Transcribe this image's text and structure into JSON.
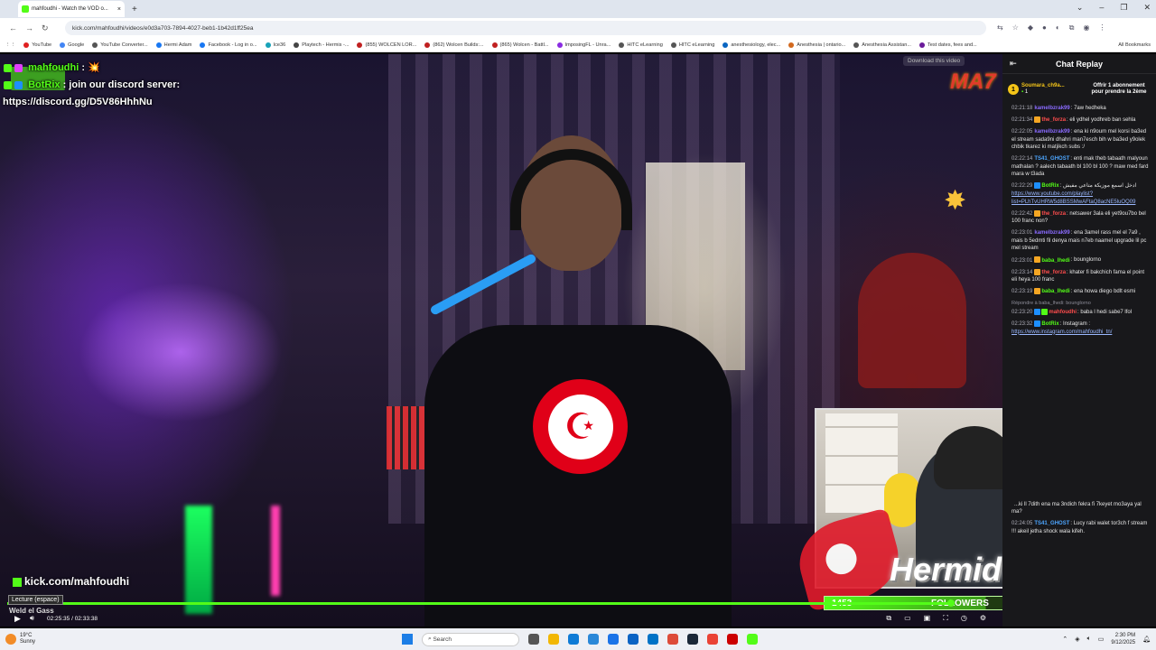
{
  "browser": {
    "tab_title": "mahfoudhi - Watch the VOD o...",
    "tab_close": "×",
    "new_tab": "+",
    "win_controls": [
      "⌄",
      "–",
      "❐",
      "✕"
    ],
    "nav": [
      "←",
      "→",
      "↻"
    ],
    "url": "kick.com/mahfoudhi/videos/e0d3a703-7894-4027-beb1-1b42d1ff25ea",
    "bookmarks": [
      {
        "label": "YouTube",
        "color": "#e02020"
      },
      {
        "label": "Google",
        "color": "#4285f4"
      },
      {
        "label": "YouTube Converter...",
        "color": "#555555"
      },
      {
        "label": "Hermi Adam",
        "color": "#1877f2"
      },
      {
        "label": "Facebook - Log in o...",
        "color": "#1877f2"
      },
      {
        "label": "Ice36",
        "color": "#17a2b8"
      },
      {
        "label": "Playtech - Hermis -...",
        "color": "#444444"
      },
      {
        "label": "(855) WOLCEN LOR...",
        "color": "#c02020"
      },
      {
        "label": "(862) Wolcen Builds:...",
        "color": "#c02020"
      },
      {
        "label": "(865) Wolcen - Battl...",
        "color": "#c02020"
      },
      {
        "label": "ImposingFL - Unra...",
        "color": "#8a2be2"
      },
      {
        "label": "HITC eLearning",
        "color": "#555555"
      },
      {
        "label": "HITC eLearning",
        "color": "#555555"
      },
      {
        "label": "anesthesiology, elec...",
        "color": "#0a66c2"
      },
      {
        "label": "Anesthesia | ontario...",
        "color": "#d2691e"
      },
      {
        "label": "Anesthesia Assistan...",
        "color": "#555555"
      },
      {
        "label": "Test dates, fees and...",
        "color": "#6a1b9a"
      }
    ],
    "all_bookmarks": "All Bookmarks"
  },
  "video": {
    "fps_badge": "60",
    "overlay_chat": {
      "line1_user": "mahfoudhi",
      "line1_text": ": 💥",
      "line2_user": "BotRix",
      "line2_text": ": join our discord server:",
      "line3_text": "https://discord.gg/D5V86HhhNu"
    },
    "ma7_logo": "MA7",
    "download_btn": "Download this video",
    "kick_url": "kick.com/mahfoudhi",
    "streamer_name": "Hermidox",
    "followers": {
      "current": "1453",
      "label": "FOLLOWERS",
      "goal": "2500",
      "fraction": 0.58
    },
    "tooltip": "Lecture (espace)",
    "weld_text": "Weld el Gass",
    "time": "02:25:35 / 02:33:38",
    "progress": 0.95
  },
  "chat": {
    "title": "Chat Replay",
    "collapse_icon": "⇤",
    "pinned": {
      "rank": "1",
      "name": "Soumara_ch9a...",
      "count": "1",
      "promo": "Offrir 1 abonnement pour prendre la 2ème"
    },
    "messages": [
      {
        "time": "02:21:18",
        "user": "kamelbzrak99",
        "color": "#8a6bff",
        "text": ": 7aw hedheka"
      },
      {
        "time": "02:21:34",
        "user": "the_forza",
        "color": "#ff4d4d",
        "text": ": eli ydhel yodhreb ban sehla"
      },
      {
        "time": "02:22:05",
        "user": "kamelbzrak99",
        "color": "#8a6bff",
        "text": ": ena ki n9oum mel korsi ba3ed el stream sada9ni dhahri man7esch bih w ba3ed y9olek chbik tkarez ki matjikch subs :/"
      },
      {
        "time": "02:22:14",
        "user": "TS41_GHOST",
        "color": "#4da6ff",
        "text": ": enti mak theb tabaath malyoun mathalan ? aalech tabaath bl 100 bl 100 ? maw med fard mara w t3ada"
      },
      {
        "time": "02:22:29",
        "user": "BotRix",
        "color": "#53fc18",
        "text": ": ادخل اسمع موزيكة متاعي مفيش",
        "link": "https://www.youtube.com/playlist?list=PLhTvUHRW5d8BSSMwAFtaQ8acNE5luOQ09"
      },
      {
        "time": "02:22:42",
        "user": "the_forza",
        "color": "#ff4d4d",
        "text": ": netsawer 3ala eli yet9ou7bo bel 100 franc non?"
      },
      {
        "time": "02:23:01",
        "user": "kamelbzrak99",
        "color": "#8a6bff",
        "text": ": ena 3amel rass mel el 7a9 , mais b 5edmti fil denya mais n7eb naamel upgrade lil pc mel stream"
      },
      {
        "time": "02:23:01",
        "user": "baba_lhedi",
        "color": "#53fc18",
        "text": ": bounglorno"
      },
      {
        "time": "02:23:14",
        "user": "the_forza",
        "color": "#ff4d4d",
        "text": ": khater fi bakchich fama el point eli heya 100 franc"
      },
      {
        "time": "02:23:19",
        "user": "baba_lhedi",
        "color": "#53fc18",
        "text": ": ena howa diego bdlt esmi"
      },
      {
        "reply": "Répondre à baba_lhedi: bounglorno",
        "time": "02:23:20",
        "user": "mahfoudhi",
        "color": "#ff4d4d",
        "text": ": baba l hedi sabe7 lfol"
      },
      {
        "time": "02:23:32",
        "user": "BotRix",
        "color": "#53fc18",
        "text": ": Instagram :",
        "link": "https://www.instagram.com/mahfoudhi_tn/"
      }
    ],
    "bottom_messages": [
      {
        "time": "",
        "user": "",
        "color": "#ffffff",
        "text": "...ki ll 7dith ena ma 3ndich fekra fi 7keyet mo3aya yal ma?"
      },
      {
        "time": "02:24:05",
        "user": "TS41_GHOST",
        "color": "#4da6ff",
        "text": ": Lucy rabi walet tor3ch f stream !!! akeil jetha shock wala kifeh."
      }
    ]
  },
  "taskbar": {
    "temp": "19°C",
    "weather": "Sunny",
    "search": "Search",
    "time": "2:30 PM",
    "date": "9/12/2025"
  }
}
